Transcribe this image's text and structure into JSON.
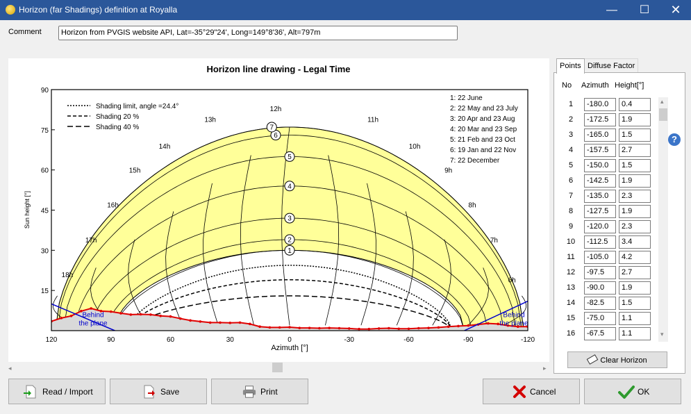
{
  "window": {
    "title": "Horizon (far Shadings) definition at Royalla",
    "minimize": "—",
    "maximize": "☐",
    "close": "✕"
  },
  "comment": {
    "label": "Comment",
    "value": "Horizon from PVGIS website API, Lat=-35°29\"24', Long=149°8'36', Alt=797m"
  },
  "chart": {
    "title": "Horizon line drawing - Legal Time",
    "ylabel": "Sun height [°]",
    "xlabel": "Azimuth [°]",
    "x_ticks": [
      "120",
      "90",
      "60",
      "30",
      "0",
      "-30",
      "-60",
      "-90",
      "-120"
    ],
    "y_ticks": [
      "15",
      "30",
      "45",
      "60",
      "75",
      "90"
    ],
    "hour_labels": [
      "18h",
      "17h",
      "16h",
      "15h",
      "14h",
      "13h",
      "12h",
      "11h",
      "10h",
      "9h",
      "8h",
      "7h",
      "6h"
    ],
    "legend_lines": [
      "Shading limit, angle =24.4°",
      "Shading 20 %",
      "Shading 40 %"
    ],
    "date_legend": [
      "1: 22 June",
      "2: 22 May and 23 July",
      "3: 20 Apr and 23 Aug",
      "4: 20 Mar and 23 Sep",
      "5: 21 Feb and 23 Oct",
      "6: 19 Jan and 22 Nov",
      "7: 22 December"
    ],
    "curve_markers": [
      "1",
      "2",
      "3",
      "4",
      "5",
      "6",
      "7"
    ],
    "behind_left": [
      "Behind",
      "the plane"
    ],
    "behind_right": [
      "Behind",
      "the plane"
    ],
    "colors": {
      "sun_zone": "#ffff99",
      "horizon": "#e00000",
      "horizon_fill": "#d9d9d9",
      "plane": "#0000cc"
    }
  },
  "chart_data": {
    "type": "line",
    "title": "Horizon line drawing - Legal Time",
    "xlabel": "Azimuth [°]",
    "ylabel": "Sun height [°]",
    "xlim": [
      120,
      -120
    ],
    "ylim": [
      0,
      90
    ],
    "series": [
      {
        "name": "Horizon",
        "x": [
          120,
          115,
          110,
          105,
          100,
          95,
          90,
          85,
          80,
          75,
          70,
          65,
          60,
          55,
          50,
          45,
          40,
          35,
          30,
          25,
          20,
          15,
          10,
          5,
          0,
          -5,
          -10,
          -15,
          -20,
          -25,
          -30,
          -35,
          -40,
          -45,
          -50,
          -55,
          -60,
          -65,
          -70,
          -75,
          -80,
          -85,
          -90,
          -95,
          -100,
          -105,
          -110,
          -115,
          -120
        ],
        "y": [
          3.5,
          4.7,
          5.5,
          7.3,
          8.3,
          7.3,
          7.1,
          6.5,
          6.0,
          6.1,
          6.0,
          5.5,
          5.3,
          4.5,
          3.8,
          3.4,
          3.0,
          3.0,
          2.9,
          3.0,
          2.5,
          1.5,
          1.2,
          1.2,
          1.3,
          1.0,
          1.0,
          0.9,
          1.0,
          0.9,
          0.8,
          0.6,
          0.6,
          0.8,
          0.9,
          0.7,
          0.7,
          0.9,
          1.0,
          1.2,
          1.5,
          1.7,
          1.9,
          2.3,
          2.7,
          2.5,
          1.9,
          1.5,
          1.5
        ]
      }
    ]
  },
  "tabs": [
    "Points",
    "Diffuse Factor"
  ],
  "points_table": {
    "headers": [
      "No",
      "Azimuth",
      "Height[°]"
    ],
    "rows": [
      [
        "1",
        "-180.0",
        "0.4"
      ],
      [
        "2",
        "-172.5",
        "1.9"
      ],
      [
        "3",
        "-165.0",
        "1.5"
      ],
      [
        "4",
        "-157.5",
        "2.7"
      ],
      [
        "5",
        "-150.0",
        "1.5"
      ],
      [
        "6",
        "-142.5",
        "1.9"
      ],
      [
        "7",
        "-135.0",
        "2.3"
      ],
      [
        "8",
        "-127.5",
        "1.9"
      ],
      [
        "9",
        "-120.0",
        "2.3"
      ],
      [
        "10",
        "-112.5",
        "3.4"
      ],
      [
        "11",
        "-105.0",
        "4.2"
      ],
      [
        "12",
        "-97.5",
        "2.7"
      ],
      [
        "13",
        "-90.0",
        "1.9"
      ],
      [
        "14",
        "-82.5",
        "1.5"
      ],
      [
        "15",
        "-75.0",
        "1.1"
      ],
      [
        "16",
        "-67.5",
        "1.1"
      ]
    ]
  },
  "help": "?",
  "buttons": {
    "clear_horizon": "Clear Horizon",
    "read_import": "Read / Import",
    "save": "Save",
    "print": "Print",
    "cancel": "Cancel",
    "ok": "OK"
  }
}
